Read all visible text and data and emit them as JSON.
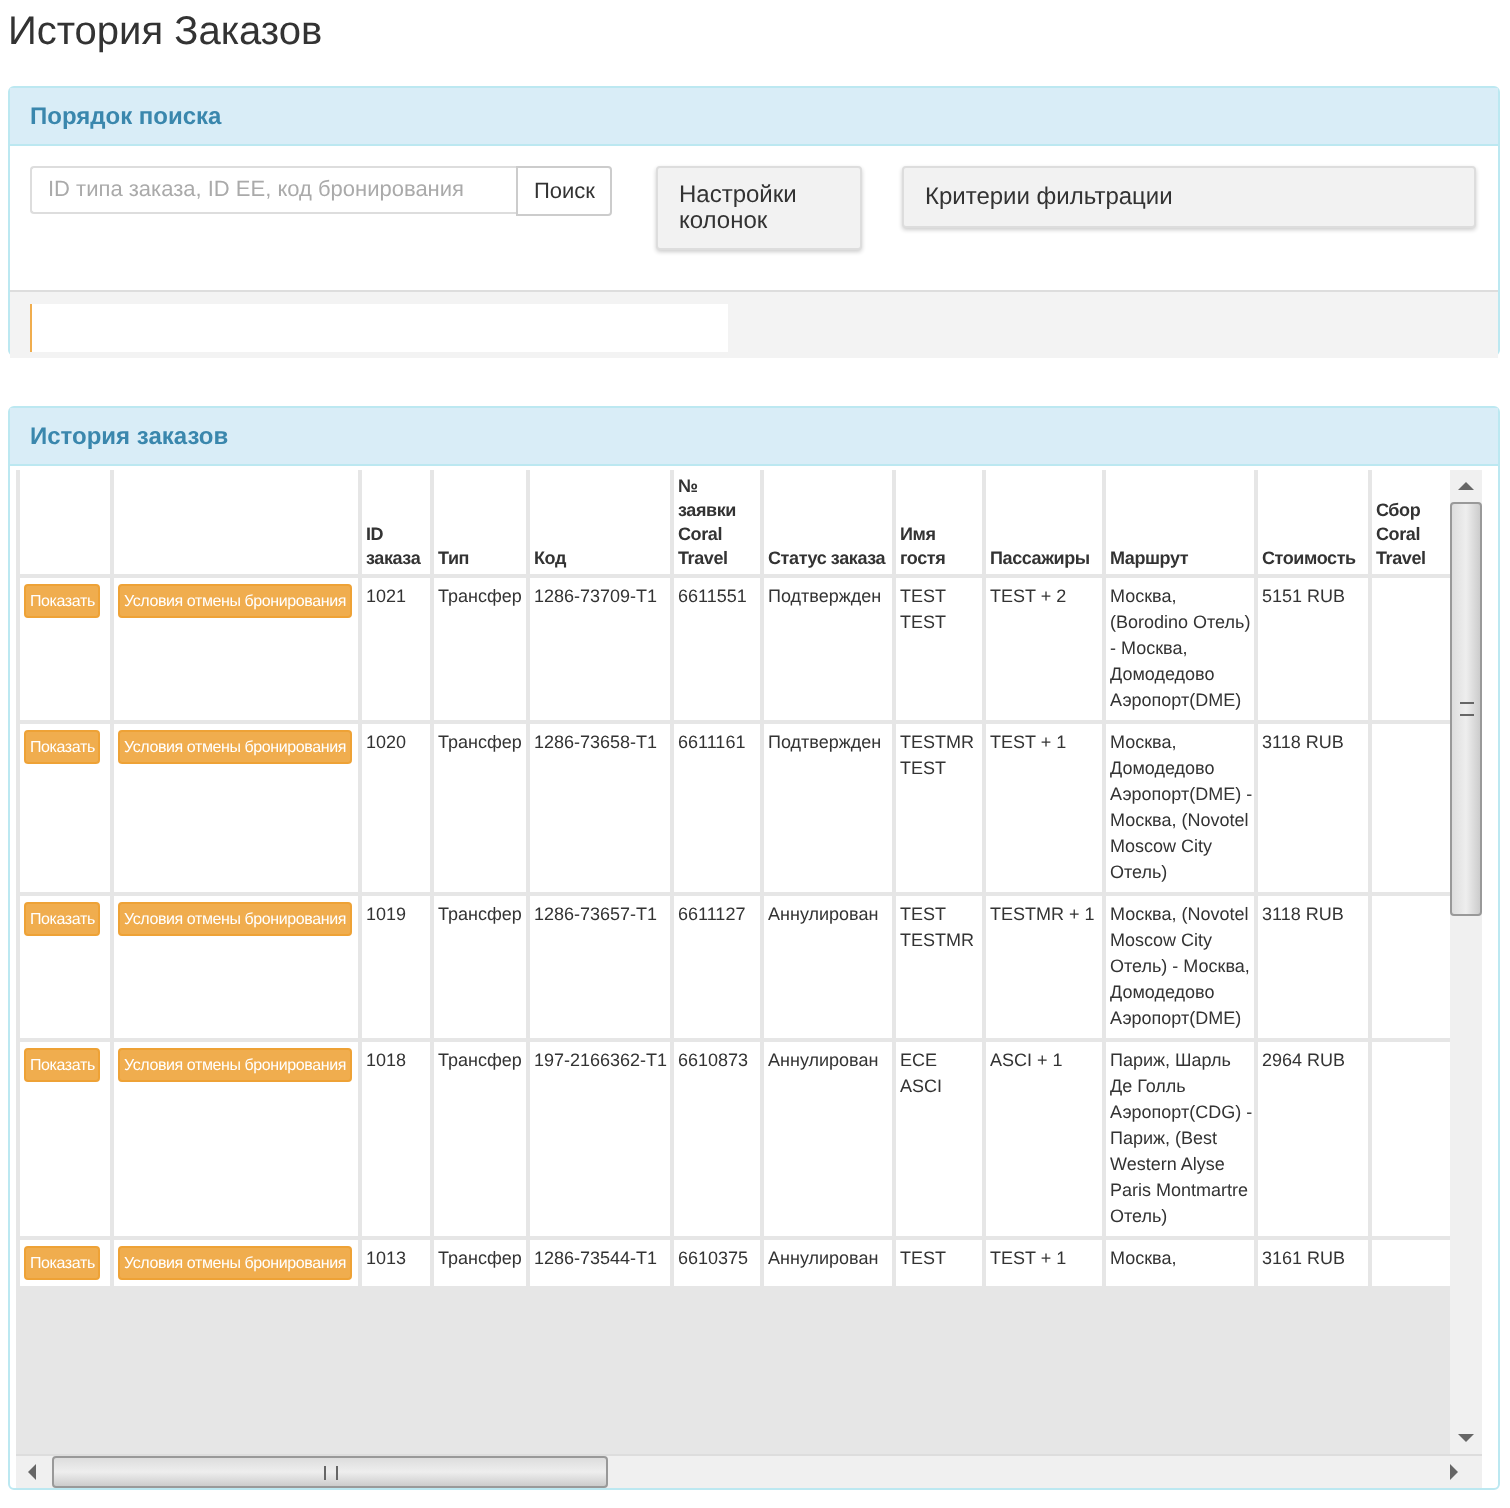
{
  "page": {
    "title": "История Заказов"
  },
  "search_panel": {
    "title": "Порядок поиска",
    "search_field": {
      "placeholder": "ID типа заказа, ID ЕЕ, код бронирования"
    },
    "search_button": "Поиск",
    "column_settings_button": "Настройки колонок",
    "filter_button": "Критерии фильтрации"
  },
  "orders_panel": {
    "title": "История заказов",
    "table": {
      "columns": [
        "ID заказа",
        "Тип",
        "Код",
        "№ заявки Coral Travel",
        "Статус заказа",
        "Имя гостя",
        "Пассажиры",
        "Маршрут",
        "Стоимость",
        "Сбор Coral Travel"
      ],
      "rows": [
        {
          "actions": [
            "Показать",
            "Условия отмены бронирования"
          ],
          "cells": [
            "1021",
            "Трансфер",
            "1286-73709-T1",
            "6611551",
            "Подтвержден",
            "TEST TEST",
            "TEST + 2",
            "Москва, (Borodino Отель) - Москва, Домодедово Аэропорт(DME)",
            "5151 RUB"
          ]
        },
        {
          "actions": [
            "Показать",
            "Условия отмены бронирования"
          ],
          "cells": [
            "1020",
            "Трансфер",
            "1286-73658-T1",
            "6611161",
            "Подтвержден",
            "TESTMR TEST",
            "TEST + 1",
            "Москва, Домодедово Аэропорт(DME) - Москва, (Novotel Moscow City Отель)",
            "3118 RUB"
          ]
        },
        {
          "actions": [
            "Показать",
            "Условия отмены бронирования"
          ],
          "cells": [
            "1019",
            "Трансфер",
            "1286-73657-T1",
            "6611127",
            "Аннулирован",
            "TEST TESTMR",
            "TESTMR + 1",
            "Москва, (Novotel Moscow City Отель) - Москва, Домодедово Аэропорт(DME)",
            "3118 RUB"
          ]
        },
        {
          "actions": [
            "Показать",
            "Условия отмены бронирования"
          ],
          "cells": [
            "1018",
            "Трансфер",
            "197-2166362-T1",
            "6610873",
            "Аннулирован",
            "ECE ASCI",
            "ASCI + 1",
            "Париж, Шарль Де Голль Аэропорт(CDG) - Париж, (Best Western Alyse Paris Montmartre Отель)",
            "2964 RUB"
          ]
        },
        {
          "actions": [
            "Показать",
            "Условия отмены бронирования"
          ],
          "cells": [
            "1013",
            "Трансфер",
            "1286-73544-T1",
            "6610375",
            "Аннулирован",
            "TEST",
            "TEST + 1",
            "Москва,",
            "3161 RUB"
          ]
        }
      ]
    }
  }
}
